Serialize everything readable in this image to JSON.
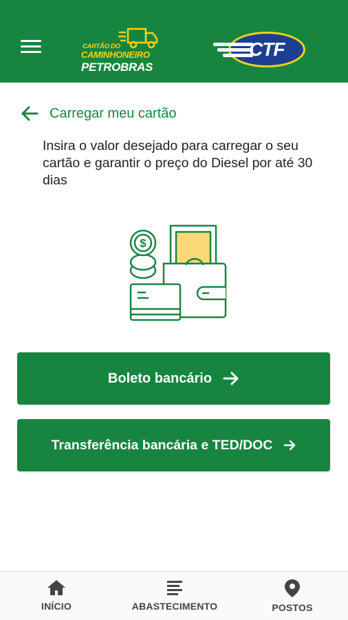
{
  "header": {
    "brand_line1": "CARTÃO DO",
    "brand_line2": "CAMINHONEIRO",
    "brand_line3": "PETROBRAS",
    "partner_logo": "CTF",
    "menu_icon": "hamburger-menu-icon"
  },
  "page": {
    "title": "Carregar meu cartão",
    "description": "Insira o valor desejado para carregar o seu cartão e garantir o preço do Diesel por até 30 dias"
  },
  "actions": {
    "boleto_label": "Boleto bancário",
    "ted_label": "Transferência bancária e TED/DOC"
  },
  "bottom_nav": [
    {
      "label": "INÍCIO",
      "icon": "home-icon"
    },
    {
      "label": "ABASTECIMENTO",
      "icon": "list-icon"
    },
    {
      "label": "POSTOS",
      "icon": "map-pin-icon"
    }
  ],
  "colors": {
    "primary_green": "#178540",
    "brand_yellow": "#f7d117",
    "illustration_yellow": "#f9d978",
    "ctf_blue": "#1d3f8f"
  }
}
